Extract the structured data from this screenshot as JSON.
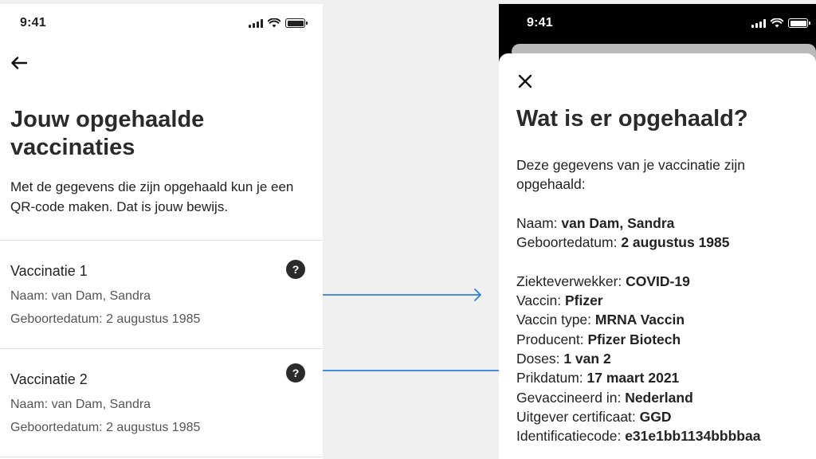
{
  "left": {
    "status_time": "9:41",
    "title": "Jouw opgehaalde vaccinaties",
    "intro": "Met de gegevens die zijn opgehaald kun je een QR-code maken. Dat is jouw bewijs.",
    "vaccinations": [
      {
        "title": "Vaccinatie 1",
        "name_line": "Naam: van Dam, Sandra",
        "birth_line": "Geboortedatum: 2 augustus 1985"
      },
      {
        "title": "Vaccinatie 2",
        "name_line": "Naam: van Dam, Sandra",
        "birth_line": "Geboortedatum: 2 augustus 1985"
      }
    ],
    "help_glyph": "?"
  },
  "right": {
    "status_time": "9:41",
    "title": "Wat is er opgehaald?",
    "intro_line1": "Deze gegevens van je vaccinatie zijn",
    "intro_line2": "opgehaald:",
    "person": [
      {
        "label": "Naam: ",
        "value": "van Dam, Sandra"
      },
      {
        "label": "Geboortedatum: ",
        "value": "2 augustus 1985"
      }
    ],
    "details": [
      {
        "label": "Ziekteverwekker: ",
        "value": "COVID-19"
      },
      {
        "label": "Vaccin: ",
        "value": "Pfizer"
      },
      {
        "label": "Vaccin type: ",
        "value": "MRNA Vaccin"
      },
      {
        "label": "Producent: ",
        "value": "Pfizer Biotech"
      },
      {
        "label": "Doses: ",
        "value": "1 van 2"
      },
      {
        "label": "Prikdatum: ",
        "value": "17 maart 2021"
      },
      {
        "label": "Gevaccineerd in: ",
        "value": "Nederland"
      },
      {
        "label": "Uitgever certificaat: ",
        "value": "GGD"
      },
      {
        "label": "Identificatiecode: ",
        "value": "e31e1bb1134bbbbaa"
      }
    ]
  },
  "colors": {
    "arrow": "#2f7fd8",
    "icon_dark": "#2b2b2b"
  },
  "icons": [
    "back-arrow-icon",
    "help-icon",
    "close-icon",
    "signal-icon",
    "wifi-icon",
    "battery-icon"
  ]
}
